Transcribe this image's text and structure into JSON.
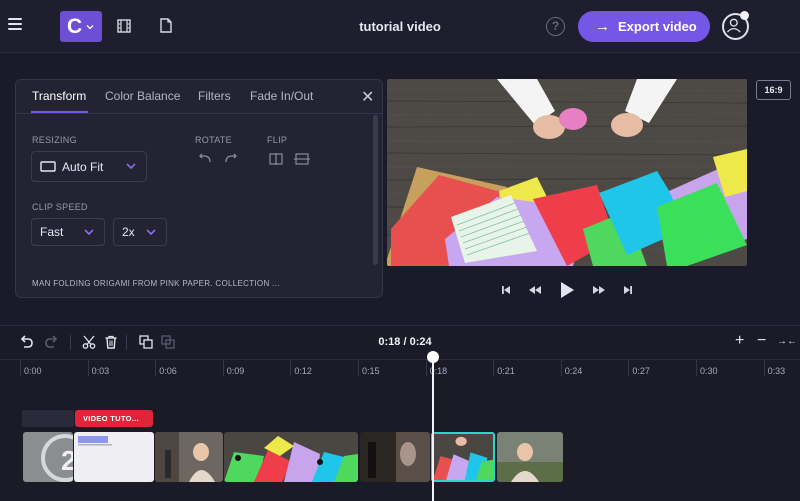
{
  "header": {
    "logo_letter": "C",
    "project_title": "tutorial video",
    "help_symbol": "?",
    "export_label": "Export video",
    "export_arrow": "→"
  },
  "panel": {
    "tabs": [
      {
        "label": "Transform",
        "active": true
      },
      {
        "label": "Color Balance",
        "active": false
      },
      {
        "label": "Filters",
        "active": false
      },
      {
        "label": "Fade In/Out",
        "active": false
      }
    ],
    "close_symbol": "✕",
    "resizing": {
      "label": "RESIZING",
      "value": "Auto Fit"
    },
    "rotate": {
      "label": "ROTATE"
    },
    "flip": {
      "label": "FLIP"
    },
    "clip_speed": {
      "label": "CLIP SPEED",
      "value": "Fast",
      "multiplier": "2x"
    },
    "clip_name": "MAN FOLDING ORIGAMI FROM PINK PAPER. COLLECTION ..."
  },
  "preview": {
    "aspect_ratio": "16:9"
  },
  "timeline": {
    "current_time": "0:18 / 0:24",
    "zoom_in": "+",
    "zoom_out": "−",
    "fit": "→←",
    "ruler_labels": [
      "0:00",
      "0:03",
      "0:06",
      "0:09",
      "0:12",
      "0:15",
      "0:18",
      "0:21",
      "0:24",
      "0:27",
      "0:30",
      "0:33"
    ],
    "text_clip_label": "VIDEO TUTO...",
    "playhead_time": "0:18"
  },
  "colors": {
    "accent": "#7557e8",
    "text_clip": "#e0243a",
    "selected_clip_border": "#25d8c8"
  },
  "icons": [
    "hamburger-icon",
    "film-icon",
    "document-icon",
    "help-icon",
    "avatar-icon",
    "undo-icon",
    "redo-icon",
    "cut-icon",
    "trash-icon",
    "duplicate-icon",
    "group-icon",
    "rotate-left-icon",
    "rotate-right-icon",
    "flip-horizontal-icon",
    "flip-vertical-icon",
    "skip-back-icon",
    "rewind-icon",
    "play-icon",
    "fast-forward-icon",
    "skip-forward-icon"
  ]
}
